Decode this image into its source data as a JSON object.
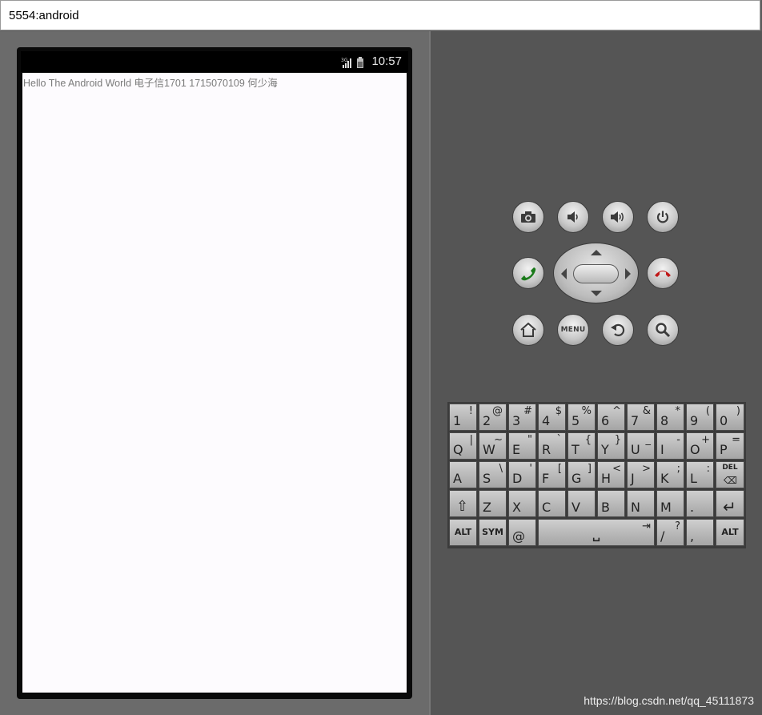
{
  "window": {
    "title": "5554:android"
  },
  "statusbar": {
    "time": "10:57",
    "network": "3G"
  },
  "screen": {
    "text": "Hello The Android World 电子信1701 1715070109 何少海"
  },
  "controls": {
    "top_row": [
      "camera-icon",
      "volume-down-icon",
      "volume-up-icon",
      "power-icon"
    ],
    "middle_row": [
      "call-icon",
      "dpad",
      "end-call-icon"
    ],
    "bottom_row": [
      "home-icon",
      "menu-button",
      "back-icon",
      "search-icon"
    ],
    "menu_label": "MENU",
    "call_color": "#1a7a1a",
    "end_call_color": "#c01818"
  },
  "keyboard": {
    "rows": [
      [
        {
          "main": "1",
          "alt": "!"
        },
        {
          "main": "2",
          "alt": "@"
        },
        {
          "main": "3",
          "alt": "#"
        },
        {
          "main": "4",
          "alt": "$"
        },
        {
          "main": "5",
          "alt": "%"
        },
        {
          "main": "6",
          "alt": "^"
        },
        {
          "main": "7",
          "alt": "&"
        },
        {
          "main": "8",
          "alt": "*"
        },
        {
          "main": "9",
          "alt": "("
        },
        {
          "main": "0",
          "alt": ")"
        }
      ],
      [
        {
          "main": "Q",
          "alt": "|"
        },
        {
          "main": "W",
          "alt": "~"
        },
        {
          "main": "E",
          "alt": "\""
        },
        {
          "main": "R",
          "alt": "`"
        },
        {
          "main": "T",
          "alt": "{"
        },
        {
          "main": "Y",
          "alt": "}"
        },
        {
          "main": "U",
          "alt": "_"
        },
        {
          "main": "I",
          "alt": "-"
        },
        {
          "main": "O",
          "alt": "+"
        },
        {
          "main": "P",
          "alt": "="
        }
      ],
      [
        {
          "main": "A",
          "alt": ""
        },
        {
          "main": "S",
          "alt": "\\"
        },
        {
          "main": "D",
          "alt": "'"
        },
        {
          "main": "F",
          "alt": "["
        },
        {
          "main": "G",
          "alt": "]"
        },
        {
          "main": "H",
          "alt": "<"
        },
        {
          "main": "J",
          "alt": ">"
        },
        {
          "main": "K",
          "alt": ";"
        },
        {
          "main": "L",
          "alt": ":"
        },
        {
          "main": "DEL",
          "alt": ""
        }
      ],
      [
        {
          "main": "⇧",
          "alt": ""
        },
        {
          "main": "Z",
          "alt": ""
        },
        {
          "main": "X",
          "alt": ""
        },
        {
          "main": "C",
          "alt": ""
        },
        {
          "main": "V",
          "alt": ""
        },
        {
          "main": "B",
          "alt": ""
        },
        {
          "main": "N",
          "alt": ""
        },
        {
          "main": "M",
          "alt": ""
        },
        {
          "main": ".",
          "alt": ""
        },
        {
          "main": "↵",
          "alt": ""
        }
      ],
      [
        {
          "main": "ALT",
          "alt": ""
        },
        {
          "main": "SYM",
          "alt": ""
        },
        {
          "main": "@",
          "alt": ""
        },
        {
          "main": "␣",
          "alt": "⇥"
        },
        {
          "main": "/",
          "alt": "?"
        },
        {
          "main": ",",
          "alt": ""
        },
        {
          "main": "ALT",
          "alt": ""
        }
      ]
    ]
  },
  "watermark": "https://blog.csdn.net/qq_45111873"
}
